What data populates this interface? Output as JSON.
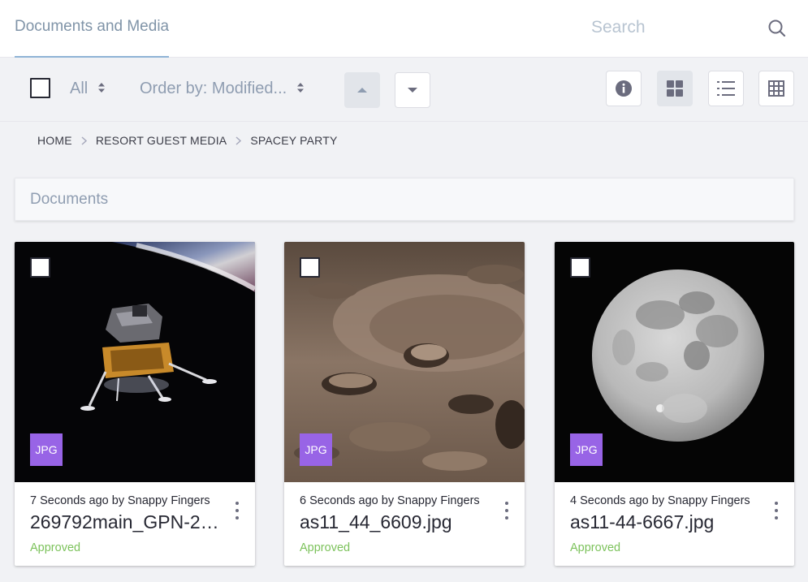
{
  "app": {
    "nav_title": "Documents and Media",
    "search": {
      "placeholder": "Search"
    }
  },
  "toolbar": {
    "filter_label": "All",
    "order_label": "Order by: Modified...",
    "sort_ascending_icon": "caret-up-icon",
    "sort_descending_icon": "caret-down-icon",
    "info_icon": "info-circle-icon",
    "view_modes": [
      "cards-view-icon",
      "list-view-icon",
      "table-view-icon"
    ],
    "active_view": "cards"
  },
  "breadcrumb": [
    "HOME",
    "RESORT GUEST MEDIA",
    "SPACEY PARTY"
  ],
  "section": {
    "title": "Documents"
  },
  "colors": {
    "badge": "#9864e6",
    "approved": "#7cc25b",
    "accent_underline": "#8fb3d6"
  },
  "documents": [
    {
      "meta": "7 Seconds ago by Snappy Fingers",
      "name": "269792main_GPN-2…",
      "type": "JPG",
      "status": "Approved",
      "thumbnail": "lunar-module-image"
    },
    {
      "meta": "6 Seconds ago by Snappy Fingers",
      "name": "as11_44_6609.jpg",
      "type": "JPG",
      "status": "Approved",
      "thumbnail": "lunar-crater-image"
    },
    {
      "meta": "4 Seconds ago by Snappy Fingers",
      "name": "as11-44-6667.jpg",
      "type": "JPG",
      "status": "Approved",
      "thumbnail": "full-moon-image"
    }
  ]
}
